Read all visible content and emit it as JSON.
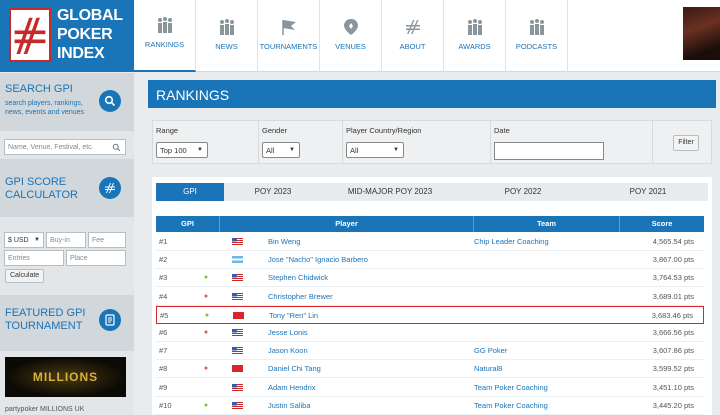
{
  "logo": {
    "line1": "GLOBAL",
    "line2": "POKER",
    "line3": "INDEX"
  },
  "nav": {
    "items": [
      {
        "label": "RANKINGS",
        "icon": "bar-chart-icon",
        "active": true
      },
      {
        "label": "NEWS",
        "icon": "bar-chart-icon"
      },
      {
        "label": "TOURNAMENTS",
        "icon": "flag-icon"
      },
      {
        "label": "VENUES",
        "icon": "map-pin-icon"
      },
      {
        "label": "ABOUT",
        "icon": "spade-logo-icon"
      },
      {
        "label": "AWARDS",
        "icon": "bar-chart-icon"
      },
      {
        "label": "PODCASTS",
        "icon": "bar-chart-icon"
      }
    ]
  },
  "sidebar": {
    "search_title": "SEARCH GPI",
    "search_sub": "search players, rankings, news, events and venues",
    "search_placeholder": "Name, Venue, Festival, etc.",
    "calc_title_1": "GPI SCORE",
    "calc_title_2": "CALCULATOR",
    "currency": "$ USD",
    "buyin_placeholder": "Buy-in",
    "fee_placeholder": "Fee",
    "entries_placeholder": "Entries",
    "place_placeholder": "Place",
    "calculate_label": "Calculate",
    "featured_title_1": "FEATURED GPI",
    "featured_title_2": "TOURNAMENT",
    "banner_text": "MILLIONS",
    "banner_caption": "partypoker MILLIONS UK"
  },
  "main": {
    "title": "RANKINGS",
    "filters": {
      "range_label": "Range",
      "range_value": "Top 100",
      "gender_label": "Gender",
      "gender_value": "All",
      "country_label": "Player Country/Region",
      "country_value": "All",
      "date_label": "Date",
      "filter_button": "Filter"
    },
    "tabs": [
      "GPI",
      "POY 2023",
      "MID-MAJOR POY 2023",
      "POY 2022",
      "POY 2021"
    ],
    "columns": {
      "gpi": "GPI",
      "player": "Player",
      "team": "Team",
      "score": "Score"
    },
    "rows": [
      {
        "rank": "#1",
        "trend": "",
        "flag": "us",
        "player": "Bin Weng",
        "team": "Chip Leader Coaching",
        "score": "4,565.54 pts"
      },
      {
        "rank": "#2",
        "trend": "",
        "flag": "ar",
        "player": "Jose \"Nacho\" Ignacio Barbero",
        "team": "",
        "score": "3,867.00 pts"
      },
      {
        "rank": "#3",
        "trend": "up",
        "flag": "us",
        "player": "Stephen Chidwick",
        "team": "",
        "score": "3,764.53 pts"
      },
      {
        "rank": "#4",
        "trend": "down",
        "flag": "us",
        "player": "Christopher Brewer",
        "team": "",
        "score": "3,689.01 pts"
      },
      {
        "rank": "#5",
        "trend": "up",
        "flag": "cn",
        "player": "Tony \"Ren\" Lin",
        "team": "",
        "score": "3,683.46 pts",
        "highlight": true
      },
      {
        "rank": "#6",
        "trend": "down",
        "flag": "us",
        "player": "Jesse Lonis",
        "team": "",
        "score": "3,666.56 pts"
      },
      {
        "rank": "#7",
        "trend": "",
        "flag": "us",
        "player": "Jason Koon",
        "team": "GG Poker",
        "score": "3,607.86 pts"
      },
      {
        "rank": "#8",
        "trend": "down",
        "flag": "hk",
        "player": "Daniel Chi Tang",
        "team": "Natural8",
        "score": "3,599.52 pts"
      },
      {
        "rank": "#9",
        "trend": "",
        "flag": "us",
        "player": "Adam Hendrix",
        "team": "Team Poker Coaching",
        "score": "3,451.10 pts"
      },
      {
        "rank": "#10",
        "trend": "up",
        "flag": "us",
        "player": "Justin Saliba",
        "team": "Team Poker Coaching",
        "score": "3,445.20 pts"
      }
    ]
  },
  "colors": {
    "brand": "#1a74b8",
    "highlight": "#d9262b",
    "up": "#7cc242",
    "down": "#e0584f"
  }
}
